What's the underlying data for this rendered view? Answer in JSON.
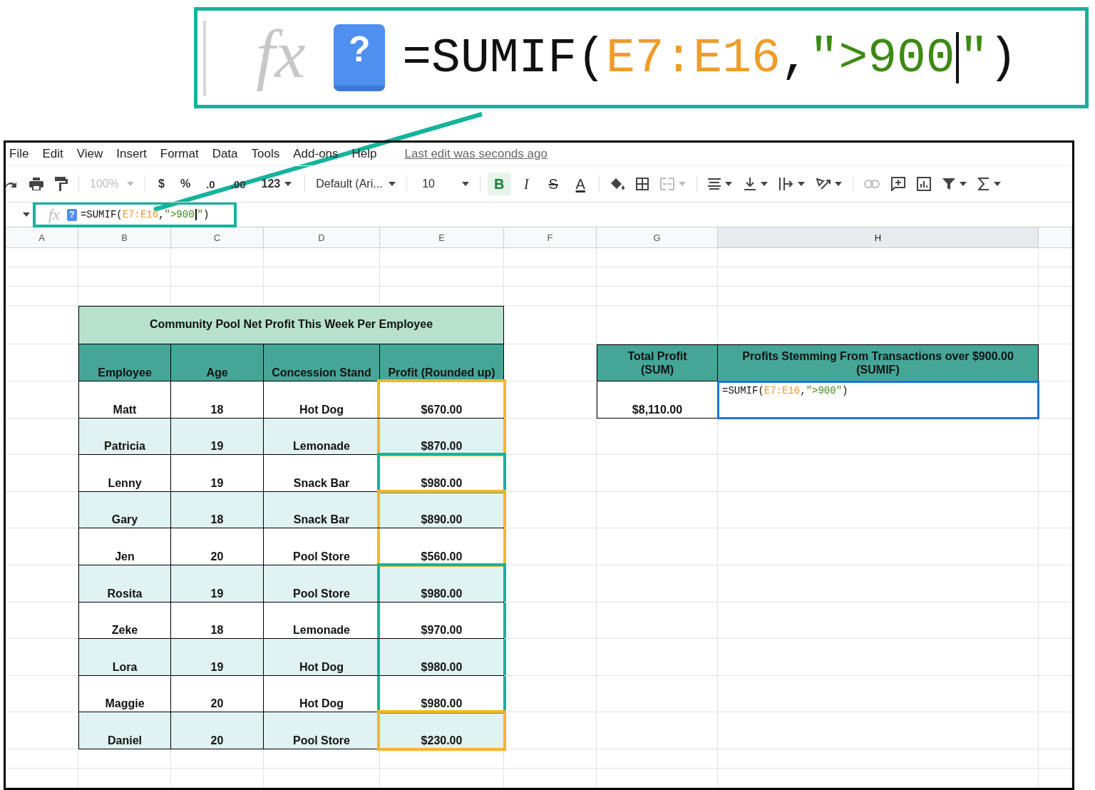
{
  "callout": {
    "fx": "fx",
    "help": "?",
    "formula": [
      {
        "text": "=SUMIF(",
        "kind": "plain"
      },
      {
        "text": "E7:E16",
        "kind": "range"
      },
      {
        "text": ",",
        "kind": "plain"
      },
      {
        "text": "\">900",
        "kind": "string"
      },
      {
        "kind": "cursor"
      },
      {
        "text": "\"",
        "kind": "string"
      },
      {
        "text": ")",
        "kind": "plain"
      }
    ]
  },
  "menu": [
    "File",
    "Edit",
    "View",
    "Insert",
    "Format",
    "Data",
    "Tools",
    "Add-ons",
    "Help"
  ],
  "last_edit": "Last edit was seconds ago",
  "toolbar": {
    "zoom": "100%",
    "currency": "$",
    "percent": "%",
    "decrease_decimal": ".0",
    "increase_decimal": ".00",
    "more_formats": "123",
    "font": "Default (Ari...",
    "font_size": "10",
    "styles": [
      {
        "label": "B",
        "kind": "bold",
        "on": true
      },
      {
        "label": "I",
        "kind": "italic",
        "on": false
      },
      {
        "label": "S",
        "kind": "strike",
        "on": false
      },
      {
        "label": "A",
        "kind": "color",
        "on": false
      }
    ]
  },
  "formula_bar": {
    "fx": "fx",
    "help": "?",
    "formula": [
      {
        "text": "=SUMIF(",
        "kind": "plain"
      },
      {
        "text": "E7:E16",
        "kind": "range"
      },
      {
        "text": ",",
        "kind": "plain"
      },
      {
        "text": "\">900",
        "kind": "string"
      },
      {
        "kind": "cursor"
      },
      {
        "text": "\"",
        "kind": "string"
      },
      {
        "text": ")",
        "kind": "plain"
      }
    ]
  },
  "columns": [
    {
      "label": "A",
      "selected": false
    },
    {
      "label": "B",
      "selected": false
    },
    {
      "label": "C",
      "selected": false
    },
    {
      "label": "D",
      "selected": false
    },
    {
      "label": "E",
      "selected": false
    },
    {
      "label": "F",
      "selected": false
    },
    {
      "label": "G",
      "selected": false
    },
    {
      "label": "H",
      "selected": true
    }
  ],
  "table": {
    "title": "Community Pool Net Profit This Week Per Employee",
    "headers": [
      "Employee",
      "Age",
      "Concession Stand",
      "Profit (Rounded up)"
    ],
    "rows": [
      {
        "employee": "Matt",
        "age": "18",
        "stand": "Hot Dog",
        "profit": "$670.00",
        "color": "#f5b62a"
      },
      {
        "employee": "Patricia",
        "age": "19",
        "stand": "Lemonade",
        "profit": "$870.00",
        "color": "#f5b62a"
      },
      {
        "employee": "Lenny",
        "age": "19",
        "stand": "Snack Bar",
        "profit": "$980.00",
        "color": "#14b39c"
      },
      {
        "employee": "Gary",
        "age": "18",
        "stand": "Snack Bar",
        "profit": "$890.00",
        "color": "#f5b62a"
      },
      {
        "employee": "Jen",
        "age": "20",
        "stand": "Pool Store",
        "profit": "$560.00",
        "color": "#f5b62a"
      },
      {
        "employee": "Rosita",
        "age": "19",
        "stand": "Pool Store",
        "profit": "$980.00",
        "color": "#14b39c"
      },
      {
        "employee": "Zeke",
        "age": "18",
        "stand": "Lemonade",
        "profit": "$970.00",
        "color": "#14b39c"
      },
      {
        "employee": "Lora",
        "age": "19",
        "stand": "Hot Dog",
        "profit": "$980.00",
        "color": "#14b39c"
      },
      {
        "employee": "Maggie",
        "age": "20",
        "stand": "Hot Dog",
        "profit": "$980.00",
        "color": "#14b39c"
      },
      {
        "employee": "Daniel",
        "age": "20",
        "stand": "Pool Store",
        "profit": "$230.00",
        "color": "#f5b62a"
      }
    ]
  },
  "summary": {
    "headers": [
      "Total Profit (SUM)",
      "Profits Stemming From Transactions over $900.00 (SUMIF)"
    ],
    "total": "$8,110.00",
    "sumif_cell": {
      "selected": true,
      "formula": [
        {
          "text": "=SUMIF(",
          "kind": "plain"
        },
        {
          "text": "E7:E16",
          "kind": "range"
        },
        {
          "text": ",",
          "kind": "plain"
        },
        {
          "text": "\">900",
          "kind": "string"
        },
        {
          "text": "\"",
          "kind": "string"
        },
        {
          "text": ")",
          "kind": "plain"
        }
      ]
    }
  }
}
